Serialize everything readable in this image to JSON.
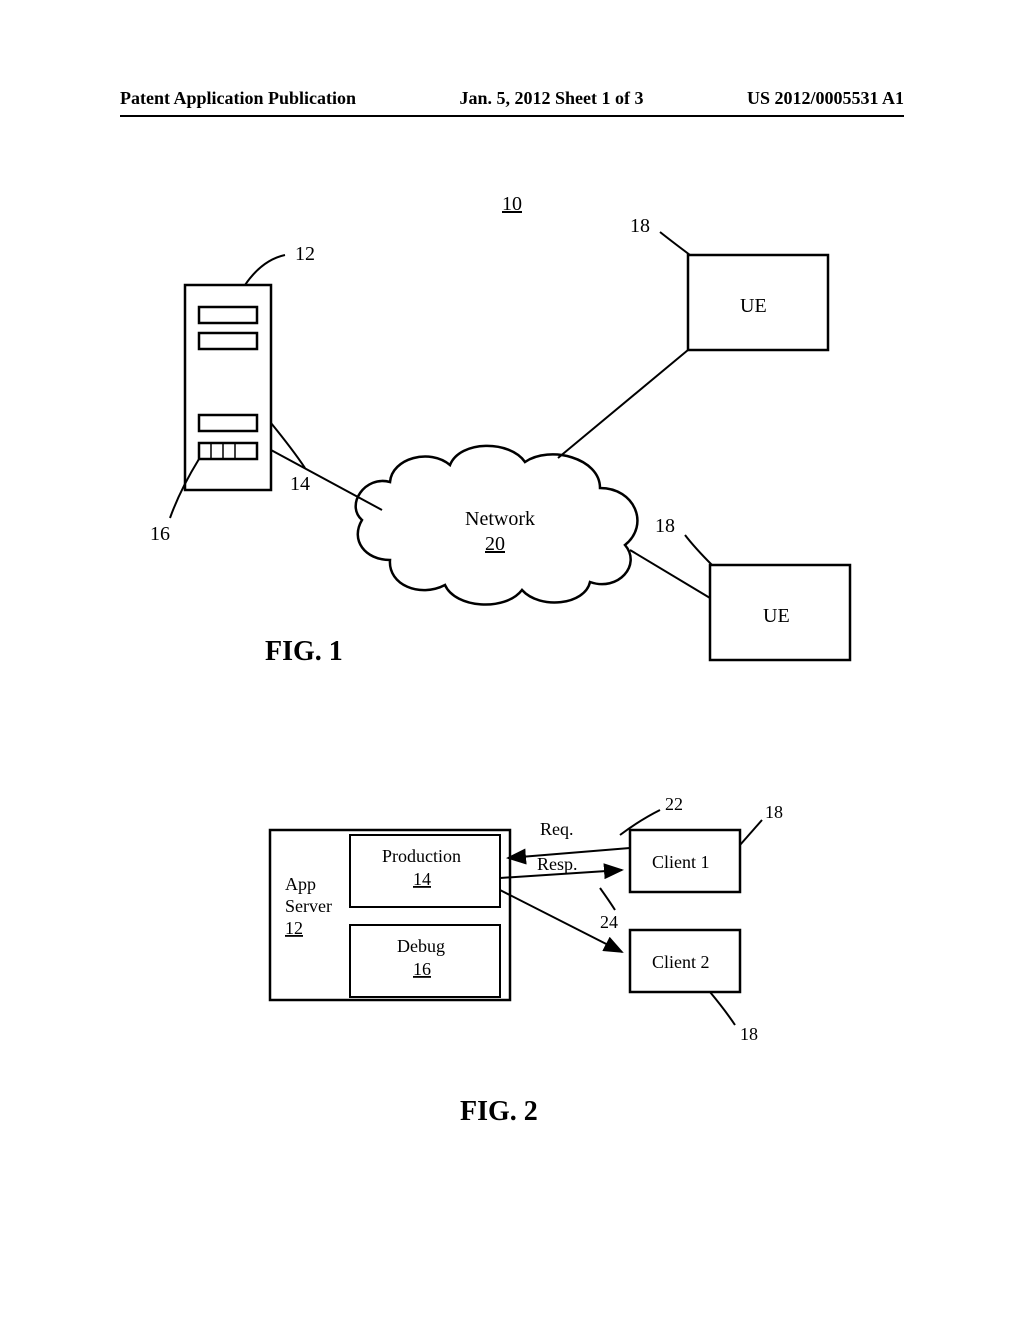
{
  "header": {
    "left": "Patent Application Publication",
    "center": "Jan. 5, 2012  Sheet 1 of 3",
    "right": "US 2012/0005531 A1"
  },
  "fig1": {
    "caption": "FIG. 1",
    "system_ref": "10",
    "server_ref": "12",
    "production_slot_ref": "14",
    "debug_slot_ref": "16",
    "ue_top_ref": "18",
    "ue_bottom_ref": "18",
    "ue_label_top": "UE",
    "ue_label_bottom": "UE",
    "network_label": "Network",
    "network_ref": "20"
  },
  "fig2": {
    "caption": "FIG. 2",
    "app_server_label_line1": "App",
    "app_server_label_line2": "Server",
    "app_server_ref": "12",
    "production_label": "Production",
    "production_ref": "14",
    "debug_label": "Debug",
    "debug_ref": "16",
    "req_label": "Req.",
    "resp_label": "Resp.",
    "req_ref": "22",
    "resp_ref": "24",
    "client1_label": "Client 1",
    "client2_label": "Client 2",
    "client1_ref": "18",
    "client2_ref": "18"
  }
}
